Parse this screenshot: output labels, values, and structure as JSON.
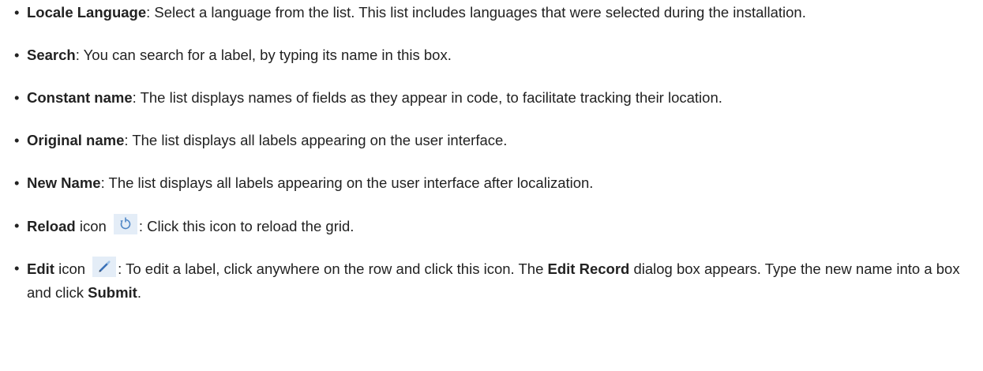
{
  "items": [
    {
      "term": "Locale Language",
      "text": ": Select a language from the list. This list includes languages that were selected during the installation."
    },
    {
      "term": "Search",
      "text": ": You can search for a label, by typing its name in this box."
    },
    {
      "term": "Constant name",
      "text": ": The list displays names of fields as they appear in code, to facilitate tracking their location."
    },
    {
      "term": "Original name",
      "text": ": The list displays all labels appearing on the user interface."
    },
    {
      "term": "New Name",
      "text": ": The list displays all labels appearing on the user interface after localization."
    },
    {
      "term": "Reload",
      "suffix": " icon ",
      "icon": "reload-icon",
      "text": ": Click this icon to reload the grid."
    },
    {
      "term": "Edit",
      "suffix": " icon ",
      "icon": "edit-icon",
      "text_a": ": To edit a label, click anywhere on the row and click this icon. The ",
      "bold_a": "Edit Record",
      "text_b": " dialog box appears. Type the new name into a box and click ",
      "bold_b": "Submit",
      "text_c": "."
    }
  ],
  "bullet": "•"
}
